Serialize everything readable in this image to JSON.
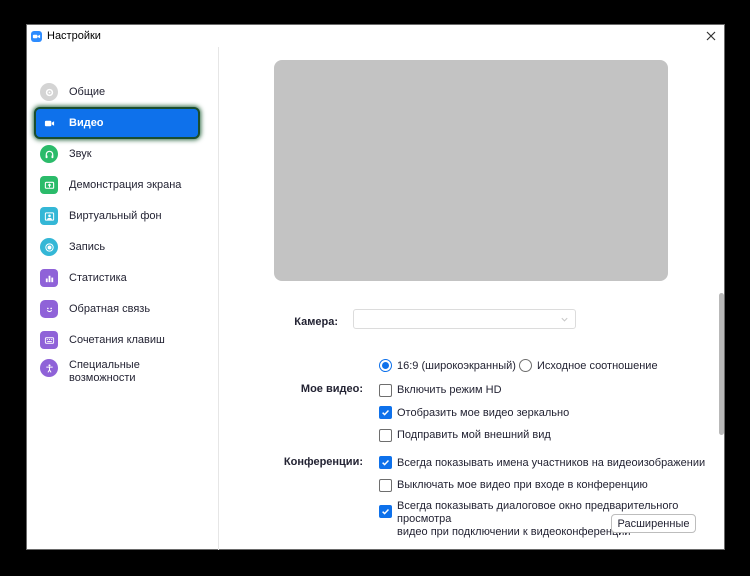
{
  "window": {
    "title": "Настройки"
  },
  "sidebar": {
    "items": [
      {
        "label": "Общие",
        "icon": "gear-icon",
        "color": "#d0d0d0"
      },
      {
        "label": "Видео",
        "icon": "video-camera-icon",
        "color": "#ffffff",
        "active": true
      },
      {
        "label": "Звук",
        "icon": "headphones-icon",
        "color": "#2bbb6a"
      },
      {
        "label": "Демонстрация экрана",
        "icon": "screen-share-icon",
        "color": "#2bbb6a"
      },
      {
        "label": "Виртуальный фон",
        "icon": "virtual-background-icon",
        "color": "#34b7d6"
      },
      {
        "label": "Запись",
        "icon": "record-icon",
        "color": "#34b7d6"
      },
      {
        "label": "Статистика",
        "icon": "statistics-icon",
        "color": "#8f62d8"
      },
      {
        "label": "Обратная связь",
        "icon": "feedback-smile-icon",
        "color": "#8f62d8"
      },
      {
        "label": "Сочетания клавиш",
        "icon": "keyboard-icon",
        "color": "#8f62d8"
      },
      {
        "label": "Специальные возможности",
        "label_line1": "Специальные",
        "label_line2": "возможности",
        "icon": "accessibility-icon",
        "color": "#8f62d8"
      }
    ]
  },
  "video": {
    "camera_label": "Камера:",
    "camera_value": "",
    "aspect": {
      "widescreen": "16:9 (широкоэкранный)",
      "original": "Исходное соотношение",
      "selected": "widescreen"
    },
    "my_video_label": "Мое видео:",
    "my_video_options": [
      {
        "label": "Включить режим HD",
        "checked": false
      },
      {
        "label": "Отобразить мое видео зеркально",
        "checked": true
      },
      {
        "label": "Подправить мой внешний вид",
        "checked": false
      }
    ],
    "meetings_label": "Конференции:",
    "meetings_options": [
      {
        "label": "Всегда показывать имена участников на видеоизображении",
        "checked": true
      },
      {
        "label": "Выключать мое видео при входе в конференцию",
        "checked": false
      },
      {
        "label": "Всегда показывать диалоговое окно предварительного просмотра видео при подключении к видеоконференции",
        "label_line1": "Всегда показывать диалоговое окно предварительного просмотра",
        "label_line2": "видео при подключении к видеоконференции",
        "checked": true
      }
    ],
    "advanced_button": "Расширенные"
  },
  "colors": {
    "accent": "#0E71EB",
    "brand": "#2D8CFF",
    "preview": "#c3c3c3"
  }
}
